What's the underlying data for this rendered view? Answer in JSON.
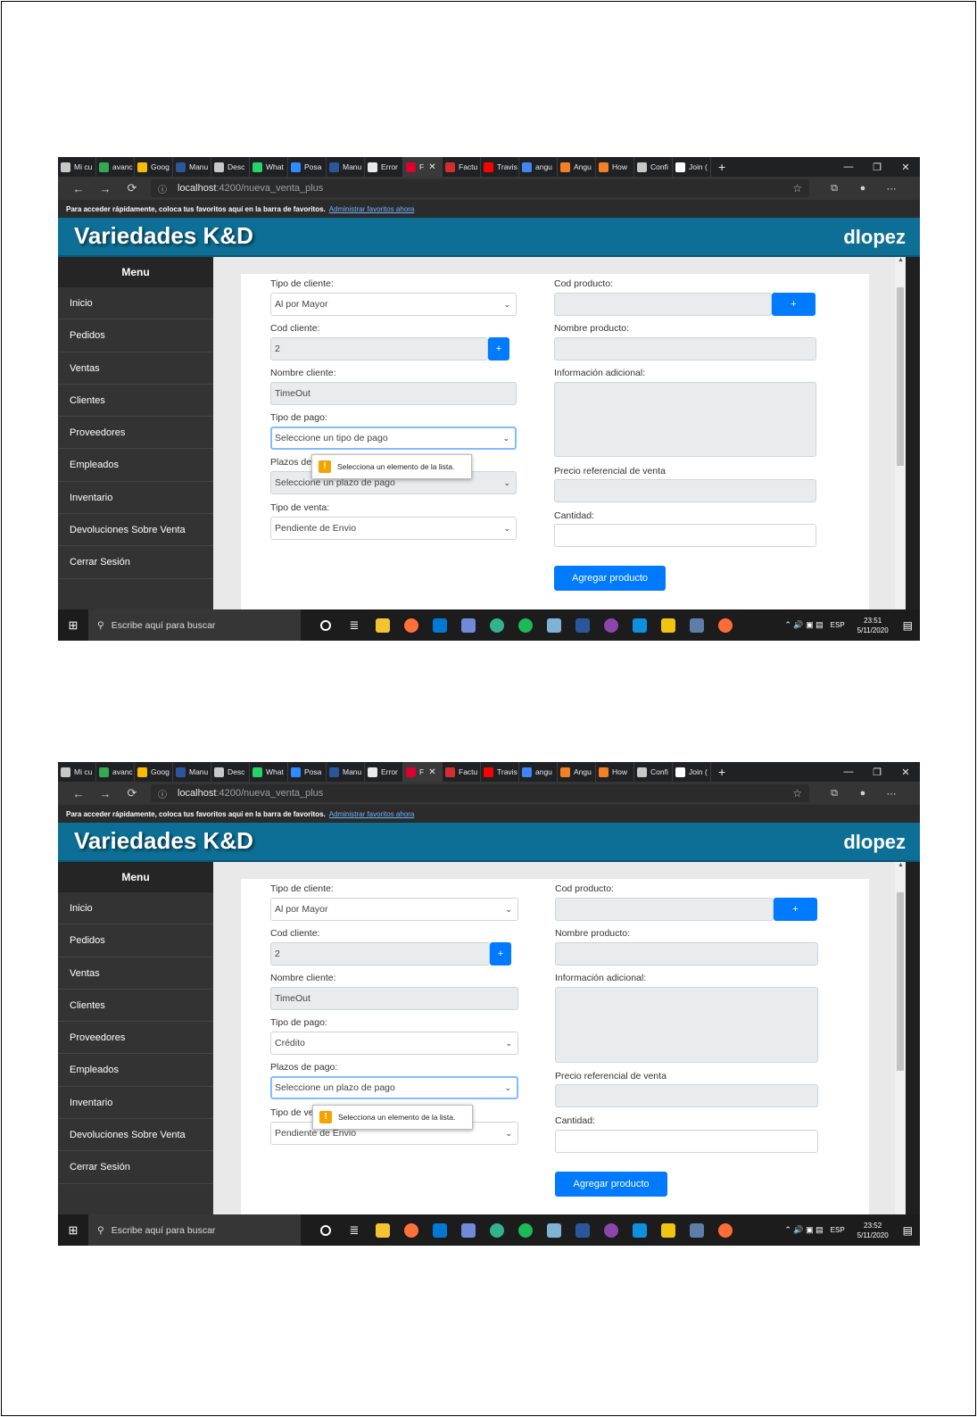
{
  "browser": {
    "tabs": [
      {
        "label": "Mi cu",
        "color": "#c8c8c8",
        "active": false
      },
      {
        "label": "avanc",
        "color": "#34a853",
        "active": false
      },
      {
        "label": "Goog",
        "color": "#fbbc04",
        "active": false
      },
      {
        "label": "Manu",
        "color": "#2b579a",
        "active": false
      },
      {
        "label": "Desc",
        "color": "#c8c8c8",
        "active": false
      },
      {
        "label": "What",
        "color": "#25d366",
        "active": false
      },
      {
        "label": "Posa",
        "color": "#2d8cff",
        "active": false
      },
      {
        "label": "Manu",
        "color": "#2b579a",
        "active": false
      },
      {
        "label": "Error",
        "color": "#e8eaed",
        "active": false
      },
      {
        "label": "F",
        "color": "#dd0031",
        "active": true
      },
      {
        "label": "Factu",
        "color": "#d32f2f",
        "active": false
      },
      {
        "label": "Travis",
        "color": "#ff0000",
        "active": false
      },
      {
        "label": "angu",
        "color": "#4285f4",
        "active": false
      },
      {
        "label": "Angu",
        "color": "#f48024",
        "active": false
      },
      {
        "label": "How",
        "color": "#f48024",
        "active": false
      },
      {
        "label": "Confi",
        "color": "#c8c8c8",
        "active": false
      },
      {
        "label": "Join (",
        "color": "#ffffff",
        "active": false
      }
    ],
    "url_host": "localhost",
    "url_path": ":4200/nueva_venta_plus",
    "favorites_text": "Para acceder rápidamente, coloca tus favoritos aquí en la barra de favoritos.",
    "favorites_link": "Administrar favoritos ahora"
  },
  "app": {
    "title": "Variedades K&D",
    "user": "dlopez"
  },
  "menu": {
    "header": "Menu",
    "items": [
      "Inicio",
      "Pedidos",
      "Ventas",
      "Clientes",
      "Proveedores",
      "Empleados",
      "Inventario",
      "Devoluciones Sobre Venta",
      "Cerrar Sesión"
    ]
  },
  "form": {
    "tipo_cliente_label": "Tipo de cliente:",
    "tipo_cliente_value": "Al por Mayor",
    "cod_cliente_label": "Cod cliente:",
    "cod_cliente_value": "2",
    "plus_label": "+",
    "nombre_cliente_label": "Nombre cliente:",
    "nombre_cliente_value": "TimeOut",
    "tipo_pago_label": "Tipo de pago:",
    "plazos_pago_label": "Plazos de pago:",
    "plazos_pago_partial_label": "Plazos de",
    "tipo_venta_label": "Tipo de venta:",
    "tipo_venta_partial_label": "Tipo de ve",
    "tipo_venta_value": "Pendiente de Envio",
    "cod_producto_label": "Cod producto:",
    "nombre_producto_label": "Nombre producto:",
    "info_adicional_label": "Información adicional:",
    "precio_label": "Precio referencial de venta",
    "cantidad_label": "Cantidad:",
    "agregar_label": "Agregar producto",
    "tooltip_text": "Selecciona un elemento de la lista."
  },
  "screens": [
    {
      "tipo_pago_value": "Seleccione un tipo de pago",
      "plazos_pago_value": "Seleccione un plazo de pago",
      "clock_time": "23:51",
      "clock_date": "5/11/2020"
    },
    {
      "tipo_pago_value": "Crédito",
      "plazos_pago_value": "Seleccione un plazo de pago",
      "clock_time": "23:52",
      "clock_date": "5/11/2020"
    }
  ],
  "taskbar": {
    "search_placeholder": "Escribe aquí para buscar",
    "language": "ESP",
    "apps": [
      {
        "name": "cortana-icon",
        "color": "#ffffff",
        "shape": "ring"
      },
      {
        "name": "task-view-icon",
        "color": "#ffffff",
        "shape": "glyph"
      },
      {
        "name": "file-explorer-icon",
        "color": "#f4c430",
        "shape": "sq"
      },
      {
        "name": "firefox-icon",
        "color": "#ff7139",
        "shape": "dot"
      },
      {
        "name": "mail-icon",
        "color": "#0078d4",
        "shape": "sq"
      },
      {
        "name": "discord-icon",
        "color": "#7289da",
        "shape": "sq"
      },
      {
        "name": "edge-icon",
        "color": "#2fb48d",
        "shape": "dot"
      },
      {
        "name": "spotify-icon",
        "color": "#1db954",
        "shape": "dot"
      },
      {
        "name": "notes-icon",
        "color": "#7fb3d5",
        "shape": "sq"
      },
      {
        "name": "word-icon",
        "color": "#2b579a",
        "shape": "sq"
      },
      {
        "name": "app-icon",
        "color": "#8e44ad",
        "shape": "dot"
      },
      {
        "name": "vscode-icon",
        "color": "#0e8fe0",
        "shape": "sq"
      },
      {
        "name": "git-icon",
        "color": "#f1c40f",
        "shape": "sq"
      },
      {
        "name": "tool-icon",
        "color": "#5d7ea8",
        "shape": "sq"
      },
      {
        "name": "postman-icon",
        "color": "#ff6c37",
        "shape": "dot"
      }
    ]
  }
}
